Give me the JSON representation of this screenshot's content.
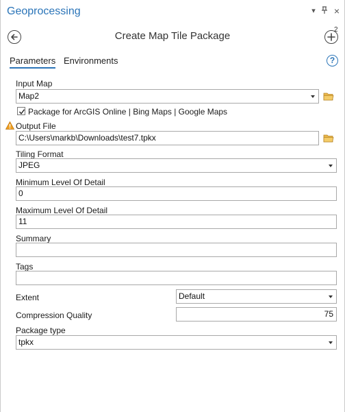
{
  "pane": {
    "title": "Geoprocessing",
    "menu_glyph": "▾",
    "pin_glyph": "⊥",
    "close_glyph": "×"
  },
  "tool": {
    "title": "Create Map Tile Package",
    "add_badge": "2"
  },
  "tabs": {
    "parameters": "Parameters",
    "environments": "Environments",
    "help": "?"
  },
  "params": {
    "input_map": {
      "label": "Input Map",
      "value": "Map2"
    },
    "package_online": {
      "label": "Package for ArcGIS Online | Bing Maps | Google Maps",
      "checked": true
    },
    "output_file": {
      "label": "Output File",
      "value": "C:\\Users\\markb\\Downloads\\test7.tpkx",
      "warning": true
    },
    "tiling_format": {
      "label": "Tiling Format",
      "value": "JPEG"
    },
    "min_lod": {
      "label": "Minimum Level Of Detail",
      "value": "0"
    },
    "max_lod": {
      "label": "Maximum Level Of Detail",
      "value": "11"
    },
    "summary": {
      "label": "Summary",
      "value": ""
    },
    "tags": {
      "label": "Tags",
      "value": ""
    },
    "extent": {
      "label": "Extent",
      "value": "Default"
    },
    "compression": {
      "label": "Compression Quality",
      "value": "75"
    },
    "package_type": {
      "label": "Package type",
      "value": "tpkx"
    }
  },
  "colors": {
    "accent": "#2a74b8",
    "folder": "#e8b64a",
    "warning": "#f0a020"
  },
  "icons": {
    "back": "back-arrow-icon",
    "add": "add-circle-icon",
    "folder": "folder-icon",
    "warning": "warning-icon",
    "help": "help-icon"
  }
}
